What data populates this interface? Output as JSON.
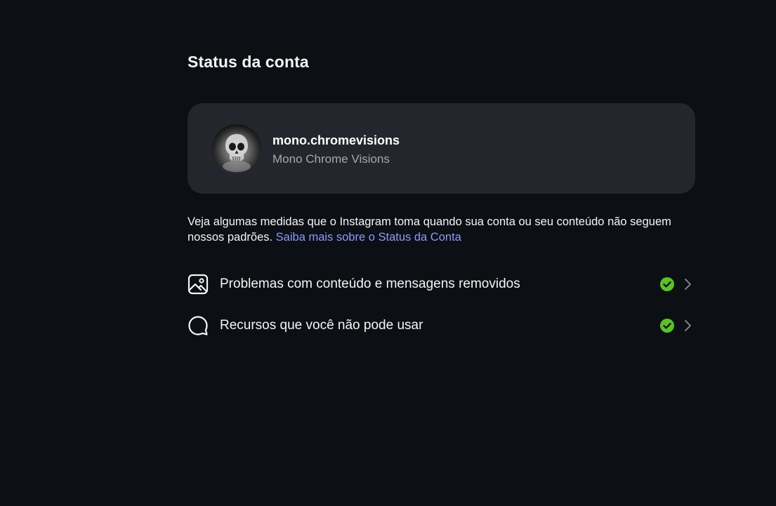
{
  "header": {
    "title": "Status da conta"
  },
  "account": {
    "username": "mono.chromevisions",
    "full_name": "Mono Chrome Visions",
    "avatar_icon": "skull-avatar"
  },
  "info": {
    "text": "Veja algumas medidas que o Instagram toma quando sua conta ou seu conteúdo não seguem nossos padrões. ",
    "link_label": "Saiba mais sobre o Status da Conta",
    "link_color": "#8b9cf7"
  },
  "status_items": [
    {
      "label": "Problemas com conteúdo e mensagens removidos",
      "icon": "image-icon",
      "status": "ok",
      "status_color": "#58c322"
    },
    {
      "label": "Recursos que você não pode usar",
      "icon": "chat-bubble-icon",
      "status": "ok",
      "status_color": "#58c322"
    }
  ],
  "colors": {
    "background": "#0c0f14",
    "card": "#23262c",
    "text": "#f5f5f5",
    "secondary_text": "#a8a8a8"
  }
}
